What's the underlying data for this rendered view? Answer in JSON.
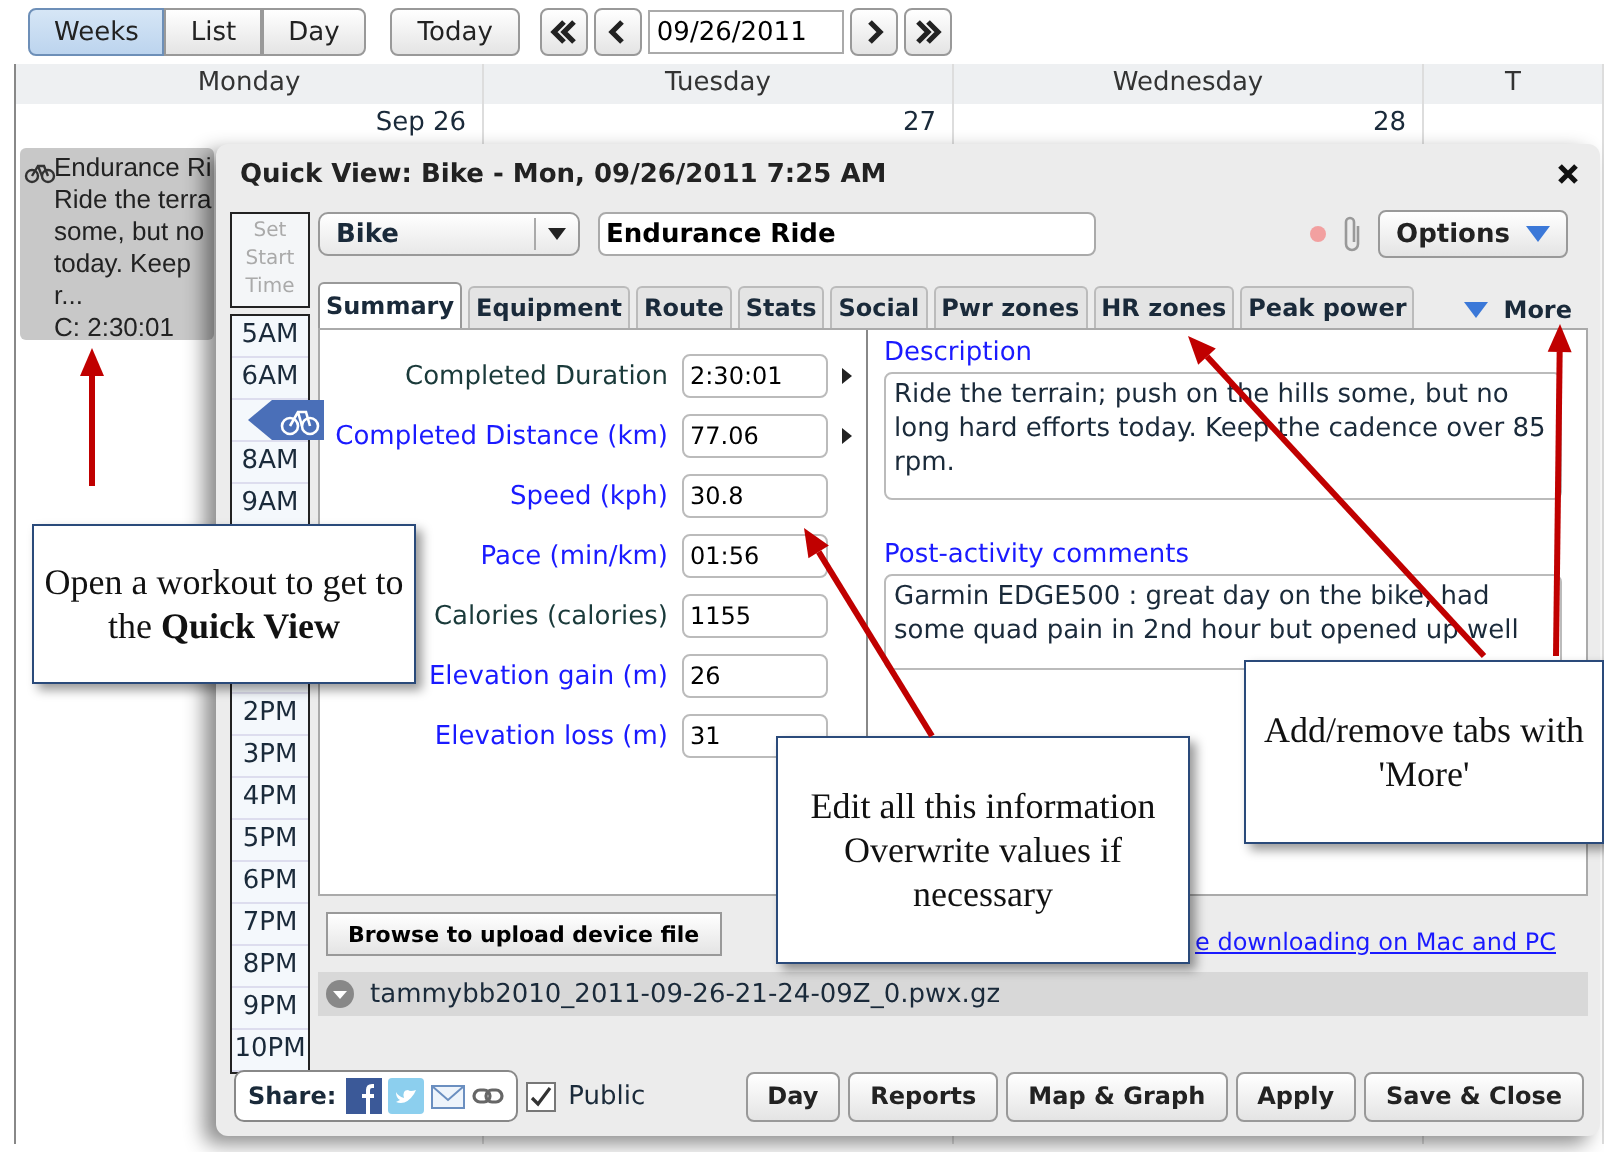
{
  "toolbar": {
    "views": [
      {
        "label": "Weeks",
        "selected": true
      },
      {
        "label": "List",
        "selected": false
      },
      {
        "label": "Day",
        "selected": false
      }
    ],
    "today": "Today",
    "date": "09/26/2011"
  },
  "calendar": {
    "days": [
      {
        "name": "Monday",
        "date": "Sep 26"
      },
      {
        "name": "Tuesday",
        "date": "27"
      },
      {
        "name": "Wednesday",
        "date": "28"
      },
      {
        "name": "T"
      }
    ],
    "event": {
      "lines": [
        "Endurance Ri",
        "Ride the terra",
        "some, but no",
        "today. Keep",
        "r...",
        "C: 2:30:01"
      ]
    }
  },
  "quick_view": {
    "title": "Quick View: Bike - Mon, 09/26/2011 7:25 AM",
    "set_start_time": {
      "label": "Set Start Time",
      "disabled": true
    },
    "time_slots": [
      {
        "kind": "label",
        "label": "5AM"
      },
      {
        "kind": "label",
        "label": "6AM"
      },
      {
        "kind": "marker"
      },
      {
        "kind": "label",
        "label": "8AM"
      },
      {
        "kind": "label",
        "label": "9AM"
      },
      {
        "kind": "blank"
      },
      {
        "kind": "blank"
      },
      {
        "kind": "blank"
      },
      {
        "kind": "blank"
      },
      {
        "kind": "label",
        "label": "2PM"
      },
      {
        "kind": "label",
        "label": "3PM"
      },
      {
        "kind": "label",
        "label": "4PM"
      },
      {
        "kind": "label",
        "label": "5PM"
      },
      {
        "kind": "label",
        "label": "6PM"
      },
      {
        "kind": "label",
        "label": "7PM"
      },
      {
        "kind": "label",
        "label": "8PM"
      },
      {
        "kind": "label",
        "label": "9PM"
      },
      {
        "kind": "label",
        "label": "10PM"
      }
    ],
    "sport": "Bike",
    "workout_title": "Endurance Ride",
    "options": "Options",
    "tabs": [
      {
        "label": "Summary",
        "selected": true
      },
      {
        "label": "Equipment",
        "selected": false
      },
      {
        "label": "Route",
        "selected": false
      },
      {
        "label": "Stats",
        "selected": false
      },
      {
        "label": "Social",
        "selected": false
      },
      {
        "label": "Pwr zones",
        "selected": false
      },
      {
        "label": "HR zones",
        "selected": false
      },
      {
        "label": "Peak power",
        "selected": false
      }
    ],
    "more": "More",
    "fields": [
      {
        "label": "Completed Duration",
        "value": "2:30:01",
        "linked": false,
        "expandable": true
      },
      {
        "label": "Completed Distance (km)",
        "value": "77.06",
        "linked": true,
        "expandable": true
      },
      {
        "label": "Speed (kph)",
        "value": "30.8",
        "linked": true,
        "expandable": false
      },
      {
        "label": "Pace (min/km)",
        "value": "01:56",
        "linked": true,
        "expandable": false
      },
      {
        "label": "Calories (calories)",
        "value": "1155",
        "linked": false,
        "expandable": false
      },
      {
        "label": "Elevation gain (m)",
        "value": "26",
        "linked": true,
        "expandable": false
      },
      {
        "label": "Elevation loss (m)",
        "value": "31",
        "linked": true,
        "expandable": false
      }
    ],
    "description": {
      "label": "Description",
      "value": "Ride the terrain; push on the hills some, but no long hard efforts today. Keep the cadence over 85 rpm."
    },
    "comments": {
      "label": "Post-activity comments",
      "value": "Garmin EDGE500 : great day on the bike, had some quad pain in 2nd hour but opened up well"
    },
    "upload_button": "Browse to upload device file",
    "help_link": "e downloading on Mac and PC",
    "file": "tammybb2010_2011-09-26-21-24-09Z_0.pwx.gz",
    "share_label": "Share:",
    "public": {
      "label": "Public",
      "checked": true
    },
    "buttons": [
      "Day",
      "Reports",
      "Map & Graph",
      "Apply",
      "Save & Close"
    ]
  },
  "callouts": [
    {
      "text": "Open a workout to get to the **Quick View**"
    },
    {
      "text": "Edit all this information Overwrite values if necessary"
    },
    {
      "text": "Add/remove tabs with 'More'"
    }
  ]
}
